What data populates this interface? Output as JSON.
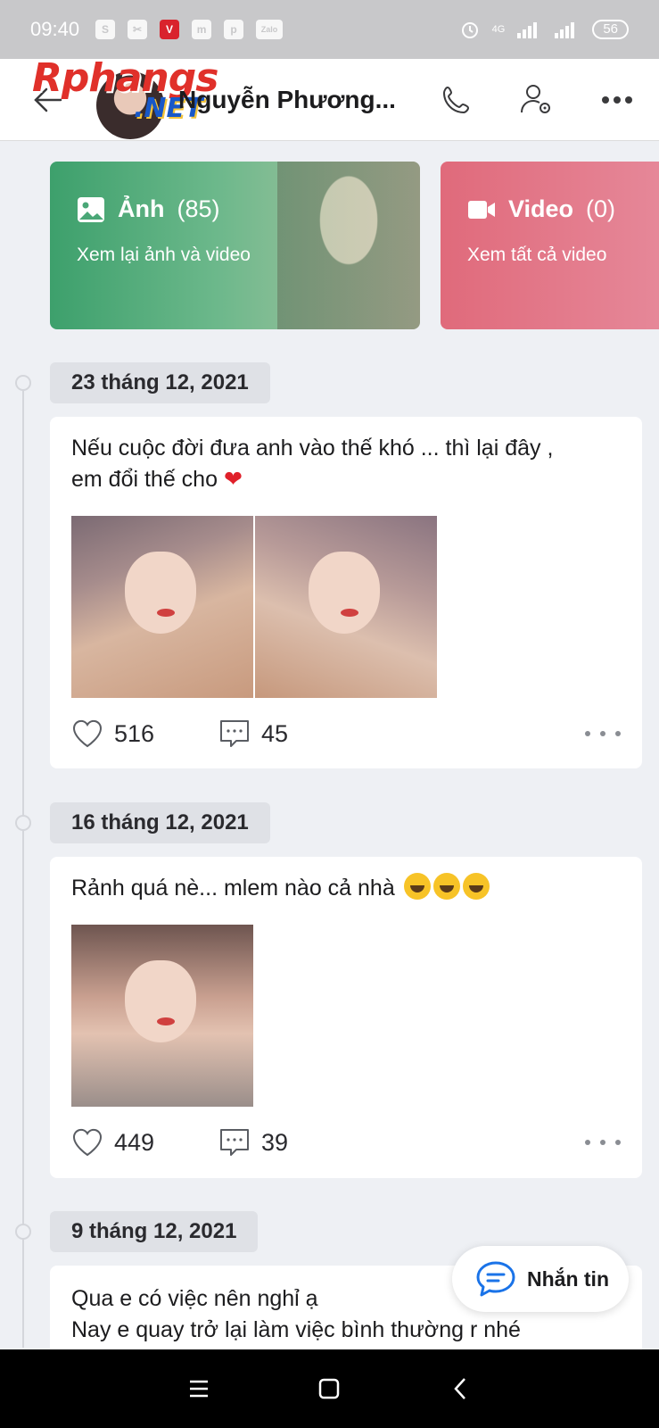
{
  "status_bar": {
    "time": "09:40",
    "left_icons": [
      "S",
      "✂",
      "V",
      "m",
      "p",
      "Zalo"
    ],
    "network": "4G",
    "battery": "56"
  },
  "header": {
    "watermark": "Rphangs",
    "watermark_suffix": ".NET",
    "title": "Nguyễn Phương..."
  },
  "media": {
    "photos": {
      "label": "Ảnh",
      "count": "(85)",
      "subtitle": "Xem lại ảnh và video"
    },
    "videos": {
      "label": "Video",
      "count": "(0)",
      "subtitle": "Xem tất cả video"
    }
  },
  "posts": [
    {
      "date": "23 tháng 12, 2021",
      "text_line1": "Nếu cuộc đời đưa anh vào thế khó ... thì lại đây ,",
      "text_line2": "em đổi thế cho",
      "emoji": "❤",
      "likes": "516",
      "comments": "45"
    },
    {
      "date": "16 tháng 12, 2021",
      "text_line1": "Rảnh quá nè... mlem nào cả nhà",
      "likes": "449",
      "comments": "39"
    },
    {
      "date": "9 tháng 12, 2021",
      "text_line1": "Qua e có việc nên nghỉ ạ",
      "text_line2": "Nay e quay trở lại làm việc bình thường r nhé"
    }
  ],
  "fab": {
    "label": "Nhắn tin"
  },
  "colors": {
    "photos_card": "#3da06c",
    "videos_card": "#e06a7b",
    "heart": "#e0202a",
    "accent_blue": "#1a73e8"
  }
}
